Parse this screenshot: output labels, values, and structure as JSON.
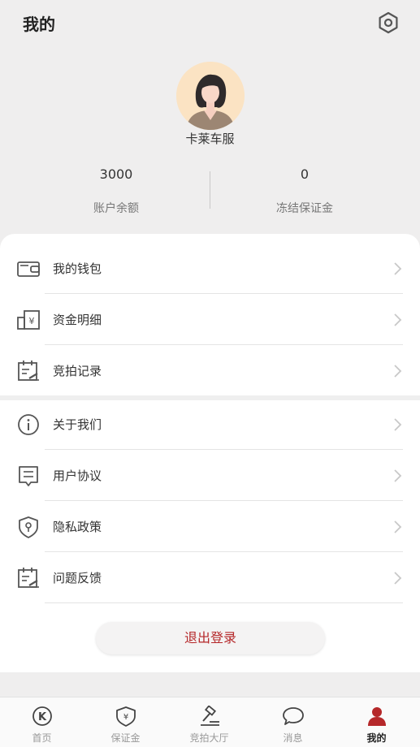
{
  "header": {
    "title": "我的",
    "settings_icon": "settings-hexagon-icon"
  },
  "profile": {
    "username": "卡莱车服",
    "avatar_icon": "female-avatar-icon"
  },
  "stats": [
    {
      "value": "3000",
      "label": "账户余额"
    },
    {
      "value": "0",
      "label": "冻结保证金"
    }
  ],
  "menu_group1": [
    {
      "label": "我的钱包",
      "icon": "wallet-icon"
    },
    {
      "label": "资金明细",
      "icon": "funds-detail-icon"
    },
    {
      "label": "竞拍记录",
      "icon": "auction-record-icon"
    }
  ],
  "menu_group2": [
    {
      "label": "关于我们",
      "icon": "info-icon"
    },
    {
      "label": "用户协议",
      "icon": "agreement-icon"
    },
    {
      "label": "隐私政策",
      "icon": "privacy-shield-icon"
    },
    {
      "label": "问题反馈",
      "icon": "feedback-icon"
    }
  ],
  "logout_label": "退出登录",
  "tabs": [
    {
      "label": "首页",
      "icon": "home-k-icon"
    },
    {
      "label": "保证金",
      "icon": "deposit-shield-icon"
    },
    {
      "label": "竞拍大厅",
      "icon": "gavel-icon"
    },
    {
      "label": "消息",
      "icon": "message-bubble-icon"
    },
    {
      "label": "我的",
      "icon": "user-icon",
      "active": true
    }
  ],
  "colors": {
    "accent": "#b5282a",
    "background": "#efeeee",
    "card": "#ffffff"
  }
}
